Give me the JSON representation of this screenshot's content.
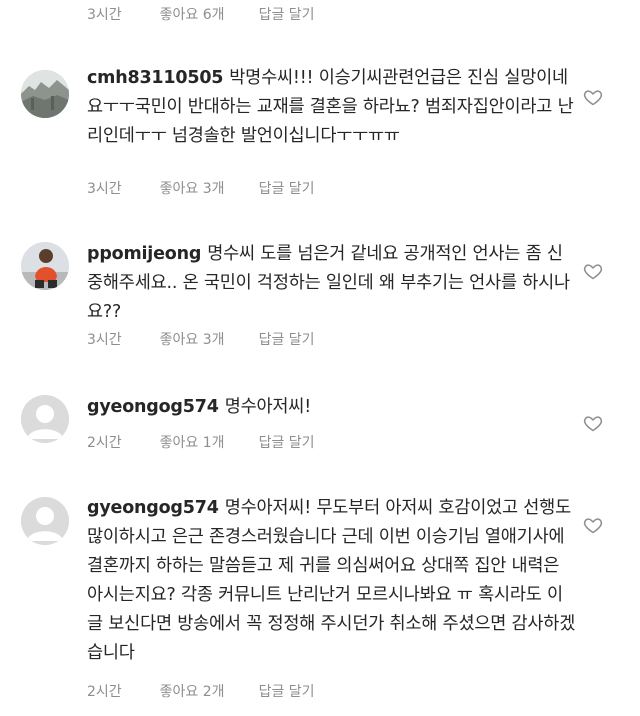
{
  "top_row": {
    "time": "3시간",
    "likes": "좋아요 6개",
    "reply": "답글 달기"
  },
  "comments": [
    {
      "username": "cmh83110505",
      "text": "박명수씨!!! 이승기씨관련언급은 진심 실망이네요ㅜㅜ국민이 반대하는 교재를 결혼을 하라뇨? 범죄자집안이라고 난리인데ㅜㅜ 넘경솔한 발언이십니다ㅜㅜㅠㅠ",
      "time": "3시간",
      "likes": "좋아요 3개",
      "reply": "답글 달기",
      "avatar": "landscape-photo"
    },
    {
      "username": "ppomijeong",
      "text": "명수씨 도를 넘은거 같네요 공개적인 언사는 좀 신중해주세요.. 온 국민이 걱정하는 일인데 왜 부추기는 언사를 하시나요??",
      "time": "3시간",
      "likes": "좋아요 3개",
      "reply": "답글 달기",
      "avatar": "person-photo"
    },
    {
      "username": "gyeongog574",
      "text": "명수아저씨!",
      "time": "2시간",
      "likes": "좋아요 1개",
      "reply": "답글 달기",
      "avatar": "default"
    },
    {
      "username": "gyeongog574",
      "text": "명수아저씨! 무도부터 아저씨 호감이었고 선행도 많이하시고 은근 존경스러웠습니다 근데 이번 이승기님 열애기사에 결혼까지 하하는 말씀듣고 제 귀를 의심써어요 상대쪽 집안 내력은 아시는지요? 각종 커뮤니트 난리난거 모르시나봐요 ㅠ 혹시라도 이 글 보신다면 방송에서 꼭 정정해 주시던가 취소해 주셨으면 감사하겠습니다",
      "time": "2시간",
      "likes": "좋아요 2개",
      "reply": "답글 달기",
      "avatar": "default"
    }
  ],
  "colors": {
    "text": "#262626",
    "meta": "#8e8e8e",
    "heart": "#8e8e8e",
    "default_avatar": "#dbdbdb"
  }
}
